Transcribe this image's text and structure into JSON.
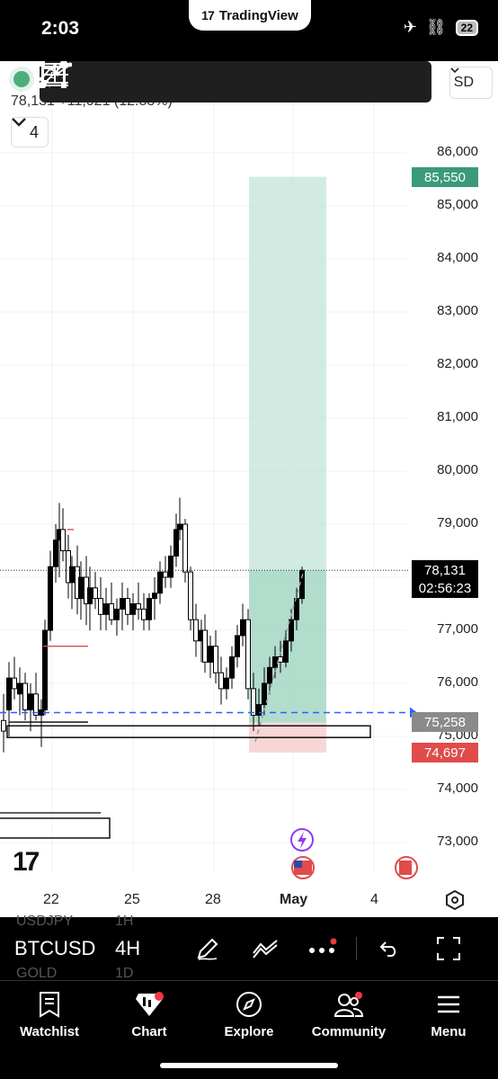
{
  "status_bar": {
    "time": "2:03",
    "app_name": "TradingView",
    "battery": "22"
  },
  "chart_header": {
    "ohlc_text": "78,131 +11,021 (12.83%)",
    "interval_count": "4",
    "symbol_suffix": "SD"
  },
  "price_axis": {
    "labels": [
      "86,000",
      "85,000",
      "84,000",
      "83,000",
      "82,000",
      "81,000",
      "80,000",
      "79,000",
      "77,000",
      "76,000",
      "75,000",
      "74,000",
      "73,000"
    ]
  },
  "price_tags": {
    "take_profit": "85,550",
    "current_price": "78,131",
    "countdown": "02:56:23",
    "entry": "75,258",
    "stop_loss": "74,697"
  },
  "time_axis": {
    "labels": [
      "22",
      "25",
      "28",
      "May",
      "4"
    ]
  },
  "symbol_bar": {
    "symbol": "BTCUSD",
    "timeframe": "4H",
    "ghost_above": {
      "symbol": "USDJPY",
      "timeframe": "1H"
    },
    "ghost_below": {
      "symbol": "GOLD",
      "timeframe": "1D"
    }
  },
  "bottom_nav": {
    "items": [
      {
        "label": "Watchlist",
        "icon": "bookmark-icon"
      },
      {
        "label": "Chart",
        "icon": "chart-icon"
      },
      {
        "label": "Explore",
        "icon": "compass-icon"
      },
      {
        "label": "Community",
        "icon": "people-icon"
      },
      {
        "label": "Menu",
        "icon": "hamburger-icon"
      }
    ]
  },
  "colors": {
    "tp_zone": "#bfe3d6",
    "sl_zone": "#f6cccc",
    "candle": "#000000",
    "entry_line": "#2962ff",
    "tag_green": "#3a9a7a",
    "tag_red": "#e04b4b"
  },
  "chart_data": {
    "type": "candlestick",
    "symbol": "BTCUSD",
    "interval": "4H",
    "y_axis_range": [
      72500,
      87000
    ],
    "x_ticks": [
      "22",
      "25",
      "28",
      "May",
      "4"
    ],
    "current_price": 78131,
    "position": {
      "entry": 75258,
      "take_profit": 85550,
      "stop_loss": 74697
    }
  }
}
